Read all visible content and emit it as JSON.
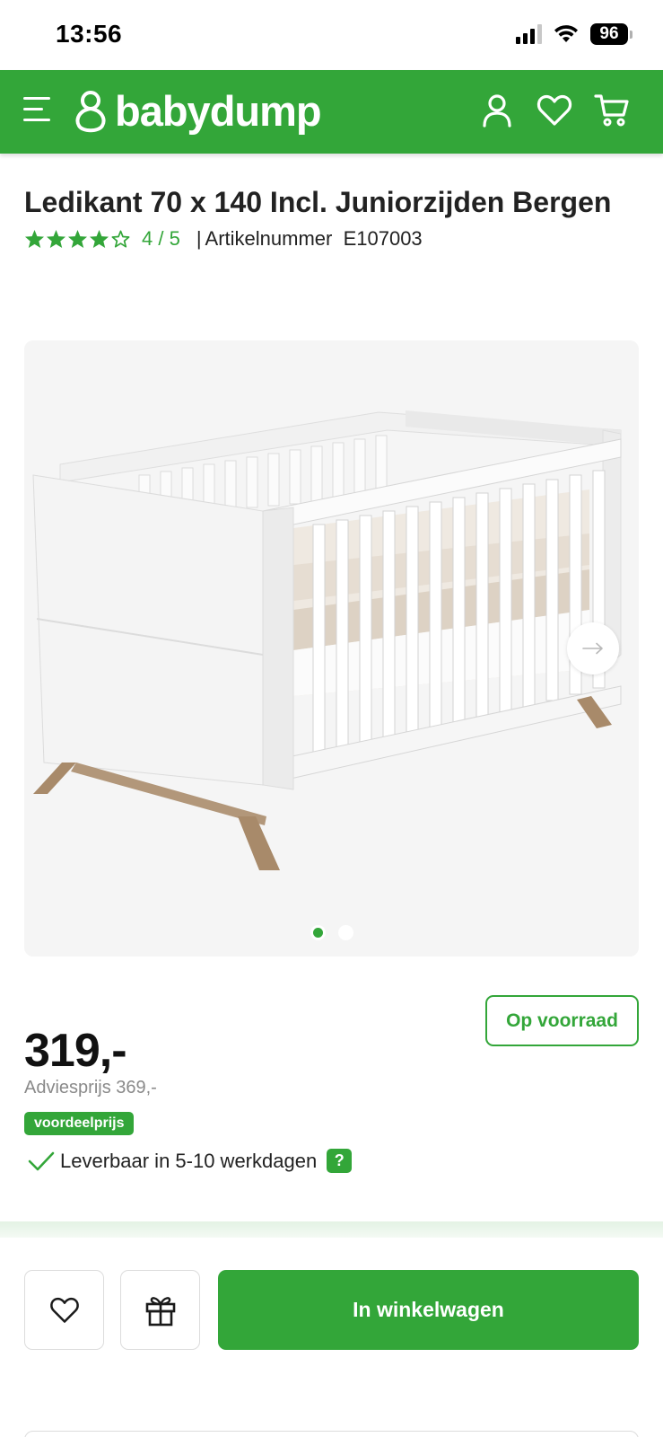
{
  "status_bar": {
    "time": "13:56",
    "battery": "96"
  },
  "header": {
    "logo_text": "babydump",
    "icons": [
      "menu-icon",
      "account-icon",
      "heart-icon",
      "cart-icon"
    ],
    "color": "#33a639"
  },
  "product": {
    "title": "Ledikant 70 x 140 Incl. Juniorzijden Bergen",
    "rating": {
      "stars_filled": 4,
      "stars_total": 5,
      "label": "4 / 5"
    },
    "article_separator": "|",
    "article_label": "Artikelnummer",
    "article_number": "E107003"
  },
  "gallery": {
    "slides": 2,
    "active_slide": 1
  },
  "pricing": {
    "stock": "Op voorraad",
    "price": "319,-",
    "advice_price": "Adviesprijs 369,-",
    "deal_badge": "voordeelprijs",
    "delivery": "Leverbaar in 5-10 werkdagen",
    "help": "?"
  },
  "actions": {
    "add_to_cart": "In winkelwagen",
    "icons": [
      "heart-icon",
      "gift-icon"
    ]
  }
}
